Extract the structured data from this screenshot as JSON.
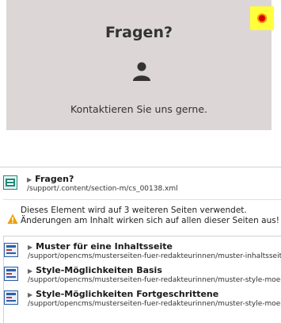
{
  "card": {
    "title": "Fragen?",
    "text": "Kontaktieren Sie uns gerne."
  },
  "element": {
    "title": "Fragen?",
    "path": "/support/.content/section-m/cs_00138.xml"
  },
  "warning": {
    "line1": "Dieses Element wird auf 3 weiteren Seiten verwendet.",
    "line2": "Änderungen am Inhalt wirken sich auf allen dieser Seiten aus!"
  },
  "pages": [
    {
      "title": "Muster für eine Inhaltsseite",
      "path": "/support/opencms/musterseiten-fuer-redakteurinnen/muster-inhaltsseite/i"
    },
    {
      "title": "Style-Möglichkeiten Basis",
      "path": "/support/opencms/musterseiten-fuer-redakteurinnen/muster-style-moeglic"
    },
    {
      "title": "Style-Möglichkeiten Fortgeschrittene",
      "path": "/support/opencms/musterseiten-fuer-redakteurinnen/muster-style-moeglic"
    }
  ],
  "icons": {
    "person": "person-icon",
    "element": "content-element-icon",
    "warning": "warning-icon",
    "page": "page-icon",
    "expand": "expand-arrow-icon"
  },
  "colors": {
    "card_bg": "#ddd6d6",
    "edit_point": "#ffff3c",
    "warning": "#f0a000",
    "element_icon": "#1f8a7a",
    "page_icon": "#2b5ea8"
  }
}
